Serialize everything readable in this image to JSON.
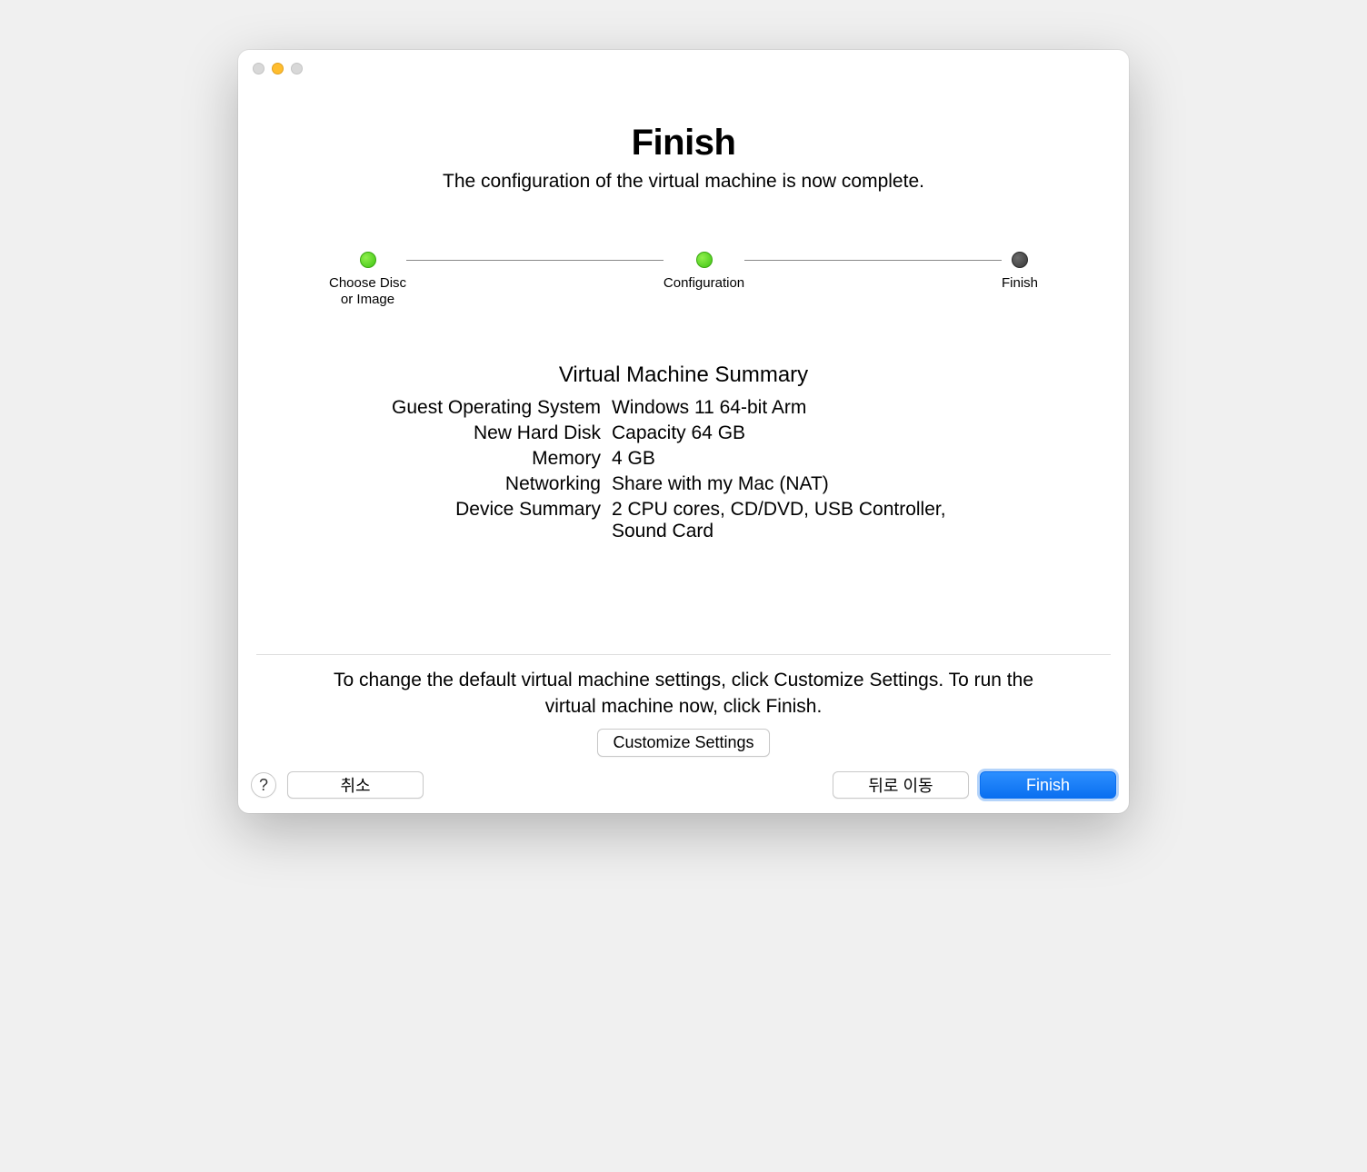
{
  "header": {
    "title": "Finish",
    "subtitle": "The configuration of the virtual machine is now complete."
  },
  "stepper": {
    "step1": "Choose Disc\nor Image",
    "step2": "Configuration",
    "step3": "Finish"
  },
  "summary": {
    "title": "Virtual Machine Summary",
    "rows": [
      {
        "label": "Guest Operating System",
        "value": "Windows 11 64-bit Arm"
      },
      {
        "label": "New Hard Disk",
        "value": "Capacity 64 GB"
      },
      {
        "label": "Memory",
        "value": "4 GB"
      },
      {
        "label": "Networking",
        "value": "Share with my Mac (NAT)"
      },
      {
        "label": "Device Summary",
        "value": "2 CPU cores, CD/DVD, USB Controller, Sound Card"
      }
    ]
  },
  "footer": {
    "text": "To change the default virtual machine settings, click Customize Settings. To run the virtual machine now, click Finish.",
    "customize": "Customize Settings"
  },
  "buttons": {
    "help": "?",
    "cancel": "취소",
    "back": "뒤로 이동",
    "finish": "Finish"
  }
}
